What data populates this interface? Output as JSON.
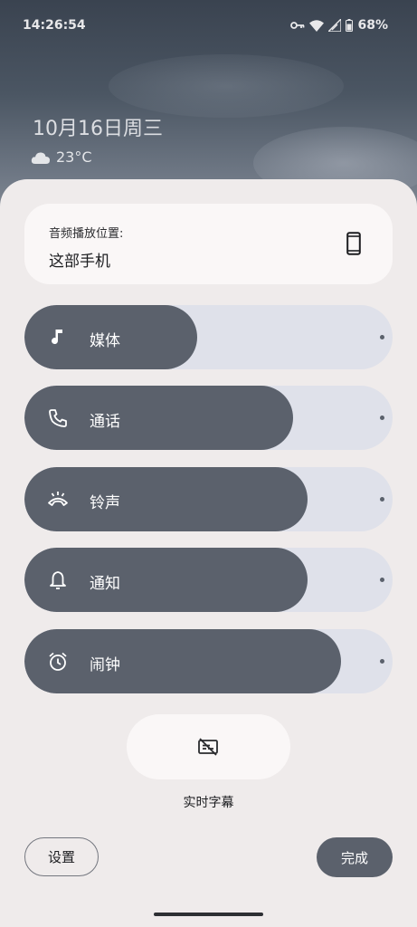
{
  "status_bar": {
    "time": "14:26:54",
    "battery": "68%",
    "icons": [
      "key-icon",
      "wifi-icon",
      "signal-icon",
      "battery-icon"
    ]
  },
  "lockscreen": {
    "date": "10月16日周三",
    "temperature": "23°C",
    "weather_icon": "cloud-icon"
  },
  "output": {
    "label": "音频播放位置:",
    "device": "这部手机",
    "icon": "phone-icon"
  },
  "sliders": [
    {
      "label": "媒体",
      "icon": "music-note-icon",
      "level": 0.47
    },
    {
      "label": "通话",
      "icon": "phone-call-icon",
      "level": 0.73
    },
    {
      "label": "铃声",
      "icon": "ringer-icon",
      "level": 0.77
    },
    {
      "label": "通知",
      "icon": "bell-icon",
      "level": 0.77
    },
    {
      "label": "闹钟",
      "icon": "alarm-icon",
      "level": 0.86
    }
  ],
  "live_caption": {
    "label": "实时字幕",
    "icon": "captions-off-icon"
  },
  "buttons": {
    "settings": "设置",
    "done": "完成"
  },
  "colors": {
    "panel_bg": "#efebeb",
    "slider_track": "#dfe1ea",
    "slider_fill": "#5b616c",
    "card_bg": "#faf7f7"
  }
}
